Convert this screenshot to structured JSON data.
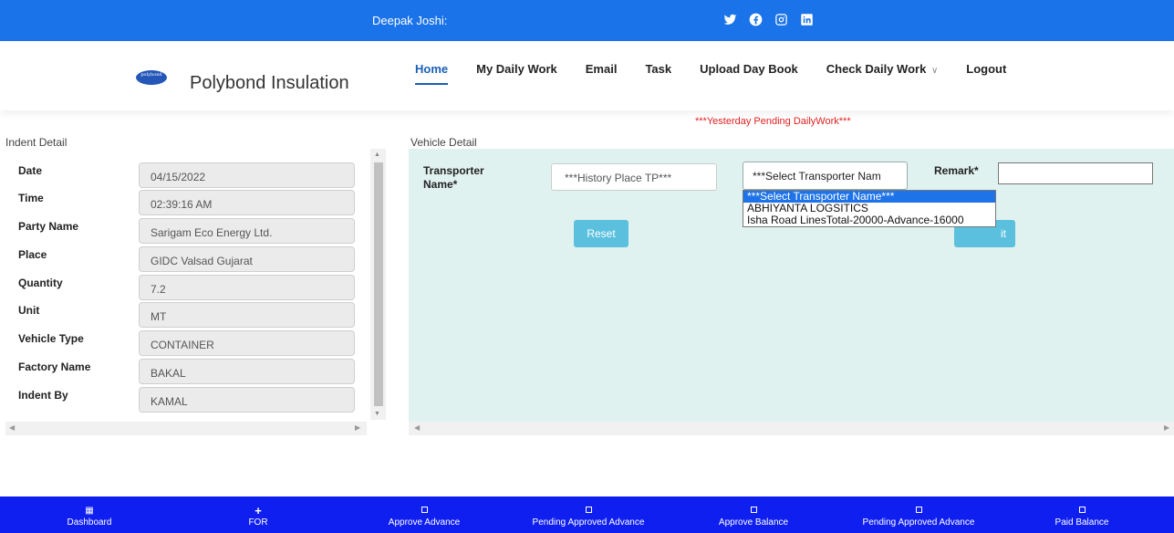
{
  "topbar": {
    "user": "Deepak Joshi:",
    "social": [
      "twitter-icon",
      "facebook-icon",
      "instagram-icon",
      "linkedin-icon"
    ]
  },
  "brand": {
    "logo_text": "polybond",
    "name": "Polybond Insulation"
  },
  "nav": [
    {
      "label": "Home",
      "active": true
    },
    {
      "label": "My Daily Work"
    },
    {
      "label": "Email"
    },
    {
      "label": "Task"
    },
    {
      "label": "Upload Day Book"
    },
    {
      "label": "Check Daily Work",
      "dropdown": true
    },
    {
      "label": "Logout"
    }
  ],
  "notice": "***Yesterday Pending DailyWork***",
  "indent": {
    "title": "Indent Detail",
    "rows": [
      {
        "label": "Date",
        "value": "04/15/2022"
      },
      {
        "label": "Time",
        "value": "02:39:16 AM"
      },
      {
        "label": "Party Name",
        "value": "Sarigam Eco Energy Ltd."
      },
      {
        "label": "Place",
        "value": "GIDC Valsad Gujarat"
      },
      {
        "label": "Quantity",
        "value": "7.2"
      },
      {
        "label": "Unit",
        "value": "MT"
      },
      {
        "label": "Vehicle Type",
        "value": "CONTAINER"
      },
      {
        "label": "Factory Name",
        "value": "BAKAL"
      },
      {
        "label": "Indent By",
        "value": "KAMAL"
      }
    ]
  },
  "vehicle": {
    "title": "Vehicle Detail",
    "transporter_label": "Transporter Name*",
    "history_placeholder": "***History Place TP***",
    "select_value": "***Select Transporter Nam",
    "options": [
      "***Select Transporter Name***",
      "ABHIYANTA LOGSITICS",
      "Isha Road LinesTotal-20000-Advance-16000"
    ],
    "remark_label": "Remark*",
    "reset_label": "Reset",
    "submit_label": "it"
  },
  "bottom": [
    {
      "label": "Dashboard",
      "icon": "grid-icon"
    },
    {
      "label": "FOR",
      "icon": "plus-icon"
    },
    {
      "label": "Approve Advance",
      "icon": "square-icon"
    },
    {
      "label": "Pending Approved Advance",
      "icon": "square-icon"
    },
    {
      "label": "Approve Balance",
      "icon": "square-icon"
    },
    {
      "label": "Pending Approved Advance",
      "icon": "square-icon"
    },
    {
      "label": "Paid Balance",
      "icon": "square-icon"
    }
  ],
  "colors": {
    "topbar": "#1a73e8",
    "bottombar": "#0f1ff0",
    "panel": "#e0f2ef",
    "accent_button": "#5bc0de",
    "notice": "#e02020"
  }
}
